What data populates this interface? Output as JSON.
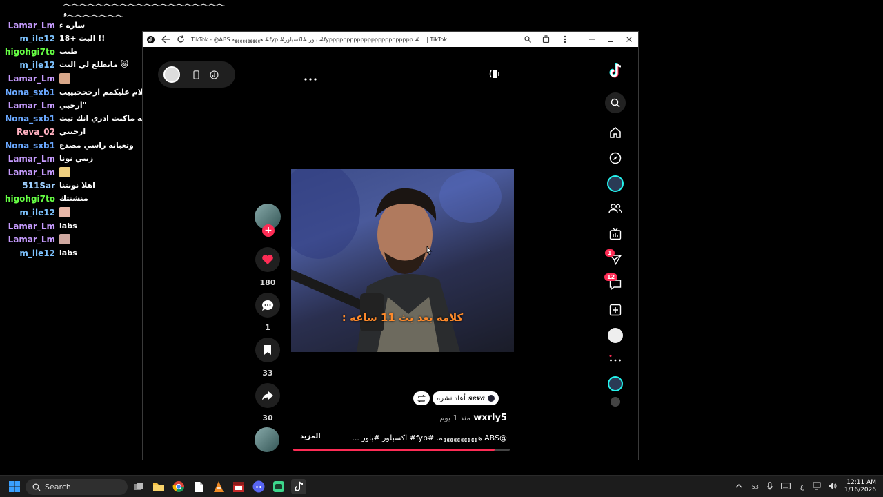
{
  "chat": {
    "top_lines": [
      "𓂃𓂃𓂃𓂃𓂃𓂃𓂃𓂃𓂃𓂃𓂃𓂃𓂃𓂃𓂃𓂃𓂃𓂃𓂃𓂃",
      "ء𓂃𓂃𓂃𓂃𓂃𓂃𓂃"
    ],
    "messages": [
      {
        "user": "Lamar_Lm",
        "color": "#c79cff",
        "text": "ساره ء"
      },
      {
        "user": "m_ile12",
        "color": "#7ec3ff",
        "text": "البث +18 !!"
      },
      {
        "user": "higohgi7to",
        "color": "#66ff44",
        "text": "طيب"
      },
      {
        "user": "m_ile12",
        "color": "#7ec3ff",
        "text": "مايطلع لي البث 😿"
      },
      {
        "user": "Lamar_Lm",
        "color": "#c79cff",
        "text": ""
      },
      {
        "user": "Nona_sxb1",
        "color": "#6aa8ff",
        "text": "سلام عليكمم ارحححبييب"
      },
      {
        "user": "Lamar_Lm",
        "color": "#c79cff",
        "text": "ارحبي\""
      },
      {
        "user": "Nona_sxb1",
        "color": "#6aa8ff",
        "text": "والله ماكنت ادري انك تبث"
      },
      {
        "user": "Reva_02",
        "color": "#ffb0c0",
        "text": "ارحبيي"
      },
      {
        "user": "Nona_sxb1",
        "color": "#6aa8ff",
        "text": "وتعبانه راسي مصدع"
      },
      {
        "user": "Lamar_Lm",
        "color": "#c79cff",
        "text": "زيبي نونا"
      },
      {
        "user": "Lamar_Lm",
        "color": "#c79cff",
        "text": ""
      },
      {
        "user": "511Sar",
        "color": "#9fd0ff",
        "text": "اهلا نونتنا"
      },
      {
        "user": "higohgi7to",
        "color": "#66ff44",
        "text": "منشنتك"
      },
      {
        "user": "m_ile12",
        "color": "#7ec3ff",
        "text": ""
      },
      {
        "user": "Lamar_Lm",
        "color": "#c79cff",
        "text": "iabs"
      },
      {
        "user": "Lamar_Lm",
        "color": "#c79cff",
        "text": ""
      },
      {
        "user": "m_ile12",
        "color": "#7ec3ff",
        "text": "iabs"
      }
    ]
  },
  "window": {
    "title": "TikTok - @ABS هههههههههههه #fyp #باور #اكسبلور #fypppppppppppppppppppppppp #... | TikTok"
  },
  "video": {
    "caption": "كلامه بعد بث 11 ساعه :",
    "likes": "180",
    "comments": "1",
    "saves": "33",
    "shares": "30",
    "repost_user": "seva",
    "repost_text": "أعاد نشره",
    "author": "wxrly5",
    "time": "منذ 1 يوم",
    "description": "@ABS هههههههههههه. #fyp# اكسبلور #باور ...",
    "more": "المزيد",
    "progress": 0.93
  },
  "sidebar": {
    "messages_badge": "1",
    "inbox_badge": "12"
  },
  "taskbar": {
    "search_placeholder": "Search",
    "tray_number": "53",
    "ime": "ع",
    "time": "12:11 AM",
    "date": "1/16/2026"
  },
  "colors": {
    "accent": "#fe2c55",
    "cyan": "#25f4ee"
  }
}
